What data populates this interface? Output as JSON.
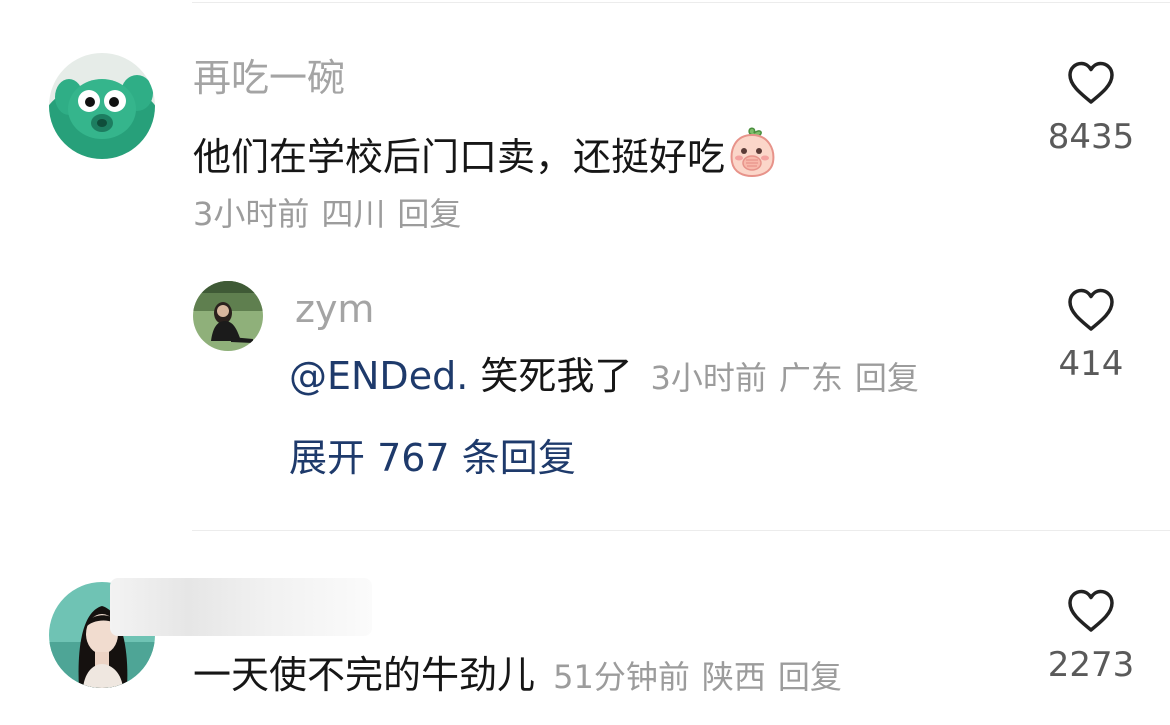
{
  "comments": [
    {
      "username": "再吃一碗",
      "text": "他们在学校后门口卖，还挺好吃",
      "emoji": "peach-covering-mouth-emoji",
      "time": "3小时前",
      "location": "四川",
      "reply_label": "回复",
      "likes": "8435",
      "replies": [
        {
          "username": "zym",
          "mention": "@ENDed.",
          "text": "笑死我了",
          "time": "3小时前",
          "location": "广东",
          "reply_label": "回复",
          "likes": "414"
        }
      ],
      "expand_label": "展开 767 条回复"
    },
    {
      "username": "",
      "text": "一天使不完的牛劲儿",
      "time": "51分钟前",
      "location": "陕西",
      "reply_label": "回复",
      "likes": "2273"
    }
  ],
  "colors": {
    "username": "#a4a4a4",
    "text": "#161616",
    "meta": "#9c9c9c",
    "link": "#1e3a6b",
    "like_count": "#5a5a5a"
  }
}
